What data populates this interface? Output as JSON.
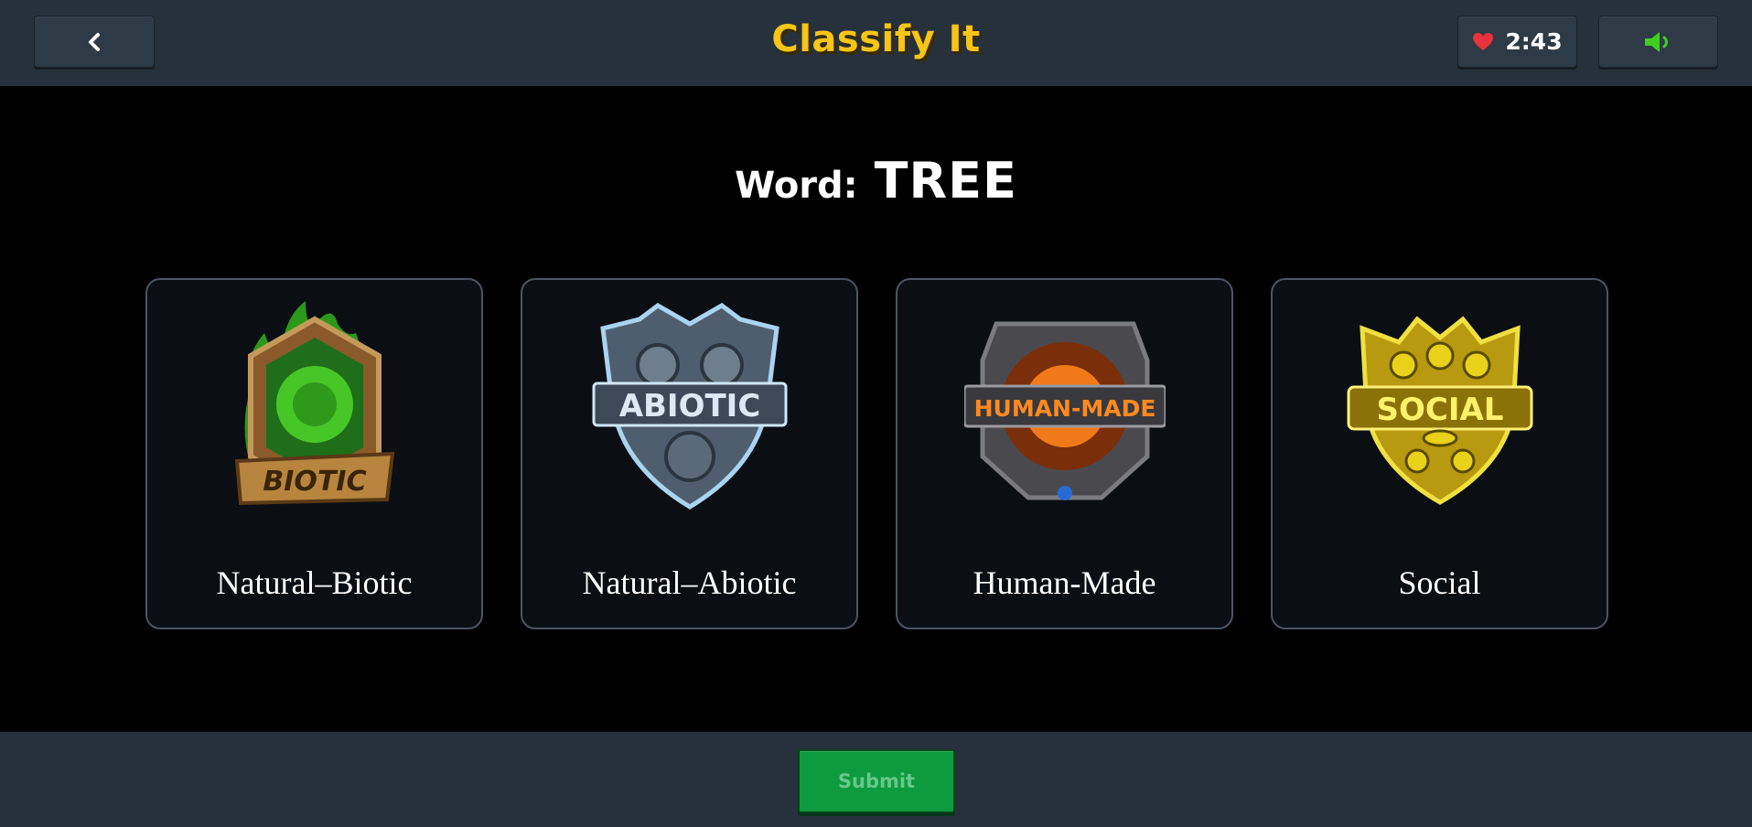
{
  "header": {
    "title": "Classify It",
    "back_icon": "chevron-left-icon",
    "timer": "2:43",
    "heart_icon": "heart-icon",
    "sound_icon": "speaker-icon"
  },
  "prompt": {
    "label": "Word:",
    "word": "TREE"
  },
  "categories": [
    {
      "label": "Natural–Biotic",
      "badge_text": "BIOTIC",
      "color": "#4bd12a"
    },
    {
      "label": "Natural–Abiotic",
      "badge_text": "ABIOTIC",
      "color": "#8cc4e8"
    },
    {
      "label": "Human-Made",
      "badge_text": "HUMAN-MADE",
      "color": "#f07a1a"
    },
    {
      "label": "Social",
      "badge_text": "SOCIAL",
      "color": "#e8d21a"
    }
  ],
  "footer": {
    "submit_label": "Submit"
  },
  "colors": {
    "title": "#f5c518",
    "submit": "#0e9a3e",
    "heart": "#e8323c",
    "sound": "#3ecf1e"
  }
}
